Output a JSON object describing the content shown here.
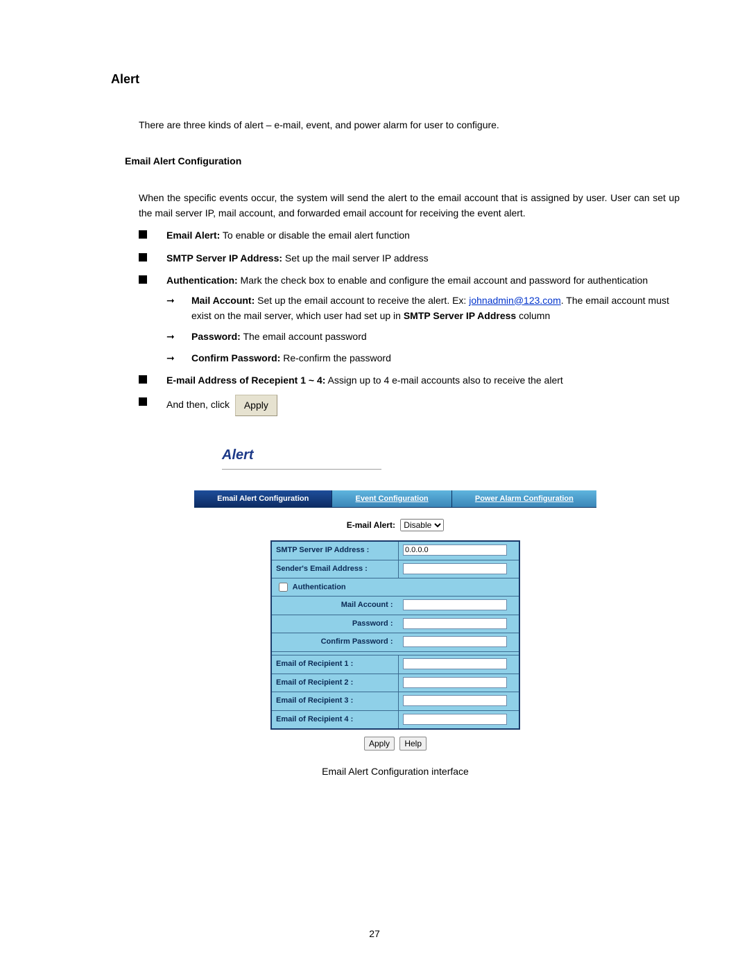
{
  "doc": {
    "heading": "Alert",
    "intro": "There are three kinds of alert – e-mail, event, and power alarm for user to configure.",
    "subheading": "Email Alert Configuration",
    "body": "When the specific events occur, the system will send the alert to the email account that is assigned by user. User can set up the mail server IP, mail account, and forwarded email account for receiving the event alert.",
    "b1_label": "Email Alert:",
    "b1_text": " To enable or disable the email alert function",
    "b2_label": "SMTP Server IP Address:",
    "b2_text": " Set up the mail server IP address",
    "b3_label": "Authentication:",
    "b3_text": " Mark the check box to enable and configure the email account and password for authentication",
    "a1_label": "Mail Account:",
    "a1_text_a": " Set up the email account to receive the alert. Ex: ",
    "a1_link": "johnadmin@123.com",
    "a1_text_b": ". The email account must exist on the mail server, which user had set up in ",
    "a1_bold": "SMTP Server IP Address",
    "a1_text_c": " column",
    "a2_label": "Password:",
    "a2_text": " The email account password",
    "a3_label": "Confirm Password:",
    "a3_text": " Re-confirm the password",
    "b4_label": "E-mail Address of Recepient 1 ~ 4:",
    "b4_text": " Assign up to 4 e-mail accounts also to receive the alert",
    "b5_text": "And then, click",
    "apply_pill": "Apply",
    "caption": "Email Alert Configuration interface",
    "page_number": "27"
  },
  "shot": {
    "alert_title": "Alert",
    "tabs": {
      "email": "Email Alert Configuration",
      "event": "Event Configuration",
      "power": "Power Alarm Configuration"
    },
    "email_alert_label": "E-mail Alert:",
    "email_alert_value": "Disable",
    "fields": {
      "smtp_label": "SMTP Server IP Address :",
      "smtp_value": "0.0.0.0",
      "sender_label": "Sender's Email Address :",
      "sender_value": "",
      "auth_label": "Authentication",
      "mail_account_label": "Mail Account :",
      "mail_account_value": "",
      "password_label": "Password :",
      "password_value": "",
      "confirm_label": "Confirm Password :",
      "confirm_value": "",
      "r1_label": "Email of Recipient 1 :",
      "r1_value": "",
      "r2_label": "Email of Recipient 2 :",
      "r2_value": "",
      "r3_label": "Email of Recipient 3 :",
      "r3_value": "",
      "r4_label": "Email of Recipient 4 :",
      "r4_value": ""
    },
    "buttons": {
      "apply": "Apply",
      "help": "Help"
    }
  }
}
